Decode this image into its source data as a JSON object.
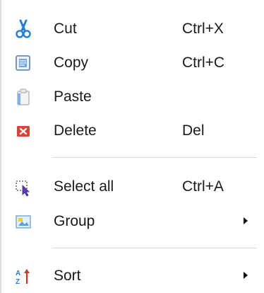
{
  "menu": {
    "items": [
      {
        "label": "Cut",
        "shortcut": "Ctrl+X",
        "icon": "scissors-icon"
      },
      {
        "label": "Copy",
        "shortcut": "Ctrl+C",
        "icon": "copy-icon"
      },
      {
        "label": "Paste",
        "shortcut": "",
        "icon": "clipboard-icon"
      },
      {
        "label": "Delete",
        "shortcut": "Del",
        "icon": "delete-icon"
      },
      {
        "label": "Select all",
        "shortcut": "Ctrl+A",
        "icon": "select-all-icon"
      },
      {
        "label": "Group",
        "shortcut": "",
        "icon": "group-icon",
        "has_submenu": true
      },
      {
        "label": "Sort",
        "shortcut": "",
        "icon": "sort-icon",
        "has_submenu": true
      }
    ]
  },
  "colors": {
    "background": "#ffffff",
    "text": "#1a1a1a",
    "separator": "#d9d9d9",
    "scissors": "#2a7fd4",
    "delete": "#d9443a"
  }
}
